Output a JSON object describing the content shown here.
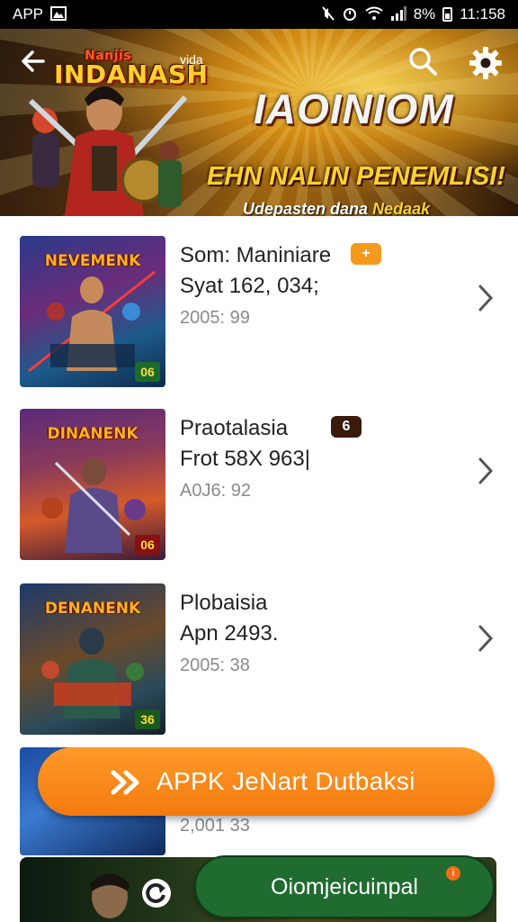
{
  "status_bar": {
    "app_label": "APP",
    "battery": "8%",
    "time": "11:158"
  },
  "banner": {
    "logo_top": "Nanjis",
    "logo": "INDANASH",
    "logo_sub": "vida",
    "title": "IAOINIOM",
    "subtitle": "EHN NALIN PENEMLISI!",
    "tag_prefix": "Udepasten dana",
    "tag_accent": "Nedaak"
  },
  "items": [
    {
      "title": "Som: Maniniare",
      "subtitle": "Syat 162, 034;",
      "meta": "2005: 99",
      "thumb_title": "NEVEMENK",
      "thumb_badge": "06",
      "tag": "+",
      "tag_color": "#f39a1e"
    },
    {
      "title": "Praotalasia",
      "subtitle": "Frot 58X 963|",
      "meta": "A0J6: 92",
      "thumb_title": "DINANENK",
      "thumb_badge": "06",
      "tag": "6",
      "tag_color": "#3a1a0c"
    },
    {
      "title": "Plobaisia",
      "subtitle": "Apn 2493.",
      "meta": "2005: 38",
      "thumb_title": "DENANENK",
      "thumb_badge": "36",
      "tag": "",
      "tag_color": ""
    },
    {
      "title": "",
      "subtitle": "",
      "meta": "2,001 33",
      "thumb_title": "",
      "thumb_badge": "",
      "tag": "",
      "tag_color": ""
    }
  ],
  "download_button": {
    "label": "APPK JeNart Dutbaksi"
  },
  "community_button": {
    "label": "Oiomjeicuinpal",
    "dot": "i"
  },
  "colors": {
    "accent_orange": "#f37a0e",
    "community_green": "#1f6b30"
  }
}
